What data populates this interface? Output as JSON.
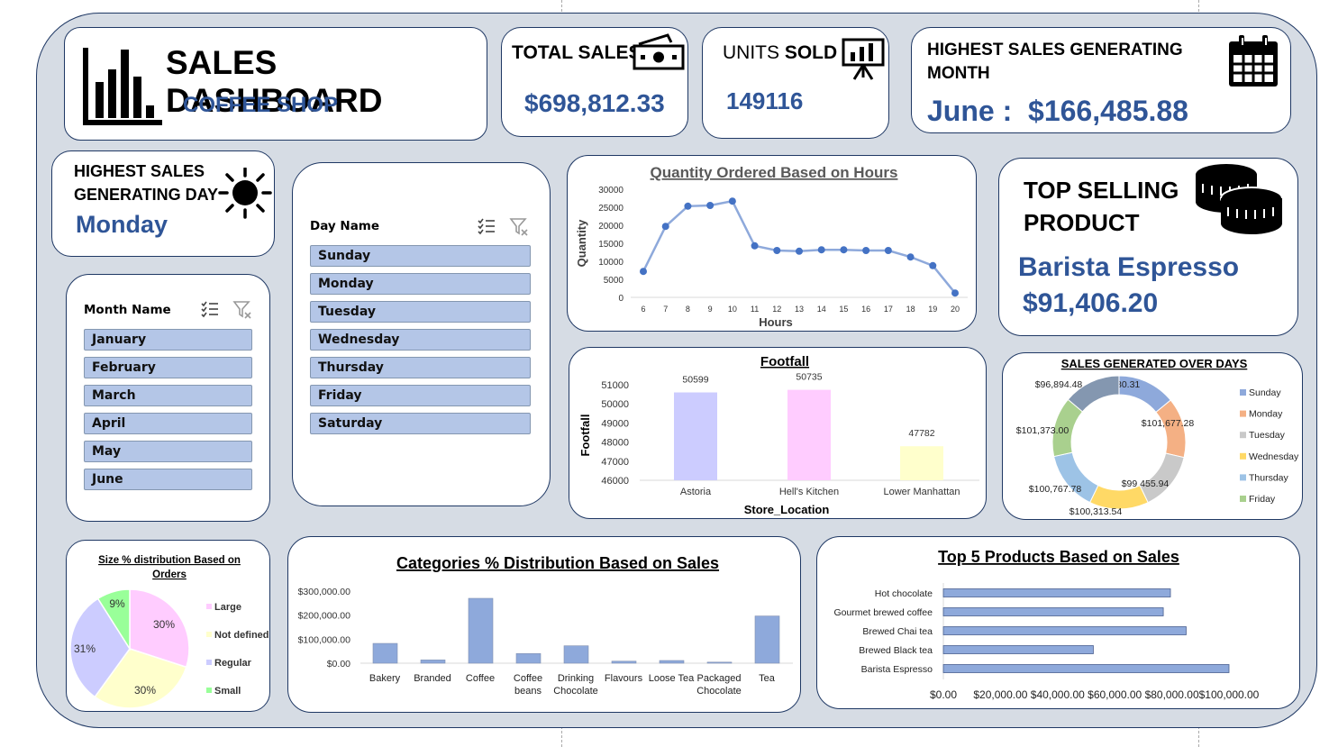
{
  "header": {
    "title": "SALES DASHBOARD",
    "subtitle": "COFFEE SHOP"
  },
  "kpis": {
    "total_sales": {
      "label": "TOTAL SALES",
      "value": "$698,812.33"
    },
    "units_sold": {
      "label_a": "UNITS ",
      "label_b": "SOLD",
      "value": "149116"
    },
    "highest_month": {
      "label_line1": "HIGHEST SALES GENERATING",
      "label_line2": "MONTH",
      "value": "June :  $166,485.88"
    },
    "highest_day": {
      "label_line1": "HIGHEST SALES",
      "label_line2": "GENERATING DAY",
      "value": "Monday"
    },
    "top_product": {
      "label_line1": "TOP SELLING",
      "label_line2": "PRODUCT",
      "name": "Barista Espresso",
      "value": "$91,406.20"
    }
  },
  "month_slicer": {
    "header": "Month Name",
    "items": [
      "January",
      "February",
      "March",
      "April",
      "May",
      "June"
    ]
  },
  "day_slicer": {
    "header": "Day Name",
    "items": [
      "Sunday",
      "Monday",
      "Tuesday",
      "Wednesday",
      "Thursday",
      "Friday",
      "Saturday"
    ]
  },
  "icons": {
    "bar_chart": "bar-chart-icon",
    "cash": "cash-icon",
    "presentation": "presentation-board-icon",
    "calendar": "calendar-icon",
    "sun": "sun-icon",
    "coins": "coins-icon",
    "multi_select": "multi-select-icon",
    "clear_filter": "clear-filter-icon"
  },
  "colors": {
    "frame": "#d6dce4",
    "border": "#1f3864",
    "accent_blue": "#2f5597",
    "slicer_item": "#b4c6e7",
    "series": "#4472c4"
  },
  "chart_data": [
    {
      "id": "quantity_hours",
      "type": "line",
      "title": "Quantity Ordered Based on Hours",
      "xlabel": "Hours",
      "ylabel": "Quantity",
      "x": [
        "6",
        "7",
        "8",
        "9",
        "10",
        "11",
        "12",
        "13",
        "14",
        "15",
        "16",
        "17",
        "18",
        "19",
        "20"
      ],
      "values": [
        7200,
        19700,
        25300,
        25500,
        26700,
        14300,
        13000,
        12800,
        13200,
        13200,
        13000,
        13000,
        11200,
        8800,
        1200
      ],
      "yticks": [
        "0",
        "5000",
        "10000",
        "15000",
        "20000",
        "25000",
        "30000"
      ],
      "ylim": [
        0,
        30000
      ],
      "color": "#4472c4"
    },
    {
      "id": "footfall",
      "type": "bar",
      "title": "Footfall",
      "xlabel": "Store_Location",
      "ylabel": "Footfall",
      "categories": [
        "Astoria",
        "Hell's Kitchen",
        "Lower Manhattan"
      ],
      "values": [
        50599,
        50735,
        47782
      ],
      "labels": [
        "50599",
        "50735",
        "47782"
      ],
      "colors": [
        "#ccccff",
        "#ffccff",
        "#ffffcc"
      ],
      "yticks": [
        "46000",
        "47000",
        "48000",
        "49000",
        "50000",
        "51000"
      ],
      "ylim": [
        46000,
        51000
      ]
    },
    {
      "id": "sales_days",
      "type": "pie",
      "title": "SALES GENERATED OVER DAYS",
      "categories": [
        "Sunday",
        "Monday",
        "Tuesday",
        "Wednesday",
        "Thursday",
        "Friday",
        "Saturday"
      ],
      "values": [
        98330.31,
        101677.28,
        99455.94,
        100313.54,
        100767.78,
        101373.0,
        96894.48
      ],
      "labels": [
        "$98,330.31",
        "$101,677.28",
        "$99,455.94",
        "$100,313.54",
        "$100,767.78",
        "$101,373.00",
        "$96,894.48"
      ],
      "legend": [
        "Sunday",
        "Monday",
        "Tuesday",
        "Wednesday",
        "Thursday",
        "Friday"
      ],
      "colors": [
        "#8ea9db",
        "#f4b084",
        "#c9c9c9",
        "#ffd966",
        "#9dc3e6",
        "#a9d08e",
        "#8497b0"
      ]
    },
    {
      "id": "size_orders",
      "type": "pie",
      "title_line1": "Size % distribution Based on",
      "title_line2": "Orders",
      "categories": [
        "Large",
        "Not defined",
        "Regular",
        "Small"
      ],
      "values": [
        30,
        30,
        31,
        9
      ],
      "labels": [
        "30%",
        "30%",
        "31%",
        "9%"
      ],
      "colors": [
        "#ffccff",
        "#ffffcc",
        "#ccccff",
        "#99ff99"
      ]
    },
    {
      "id": "categories_sales",
      "type": "bar",
      "title": "Categories % Distribution Based on Sales",
      "categories": [
        "Bakery",
        "Branded",
        "Coffee",
        "Coffee beans",
        "Drinking Chocolate",
        "Flavours",
        "Loose Tea",
        "Packaged Chocolate",
        "Tea"
      ],
      "label_lines": [
        [
          "Bakery"
        ],
        [
          "Branded"
        ],
        [
          "Coffee"
        ],
        [
          "Coffee",
          "beans"
        ],
        [
          "Drinking",
          "Chocolate"
        ],
        [
          "Flavours"
        ],
        [
          "Loose Tea"
        ],
        [
          "Packaged",
          "Chocolate"
        ],
        [
          "Tea"
        ]
      ],
      "values": [
        82316,
        13607,
        269952,
        40085,
        72416,
        8409,
        11213,
        4408,
        196406
      ],
      "yticks": [
        "$0.00",
        "$100,000.00",
        "$200,000.00",
        "$300,000.00"
      ],
      "ylim": [
        0,
        300000
      ],
      "color": "#8ea9db"
    },
    {
      "id": "top5_products",
      "type": "bar",
      "title": "Top 5 Products Based on Sales",
      "categories": [
        "Hot chocolate",
        "Gourmet brewed coffee",
        "Brewed Chai tea",
        "Brewed Black tea",
        "Barista Espresso"
      ],
      "values": [
        79500,
        77000,
        85000,
        52500,
        100000
      ],
      "xticks": [
        "$0.00",
        "$20,000.00",
        "$40,000.00",
        "$60,000.00",
        "$80,000.00",
        "$100,000.00"
      ],
      "xlim": [
        0,
        100000
      ],
      "color": "#8ea9db"
    }
  ]
}
